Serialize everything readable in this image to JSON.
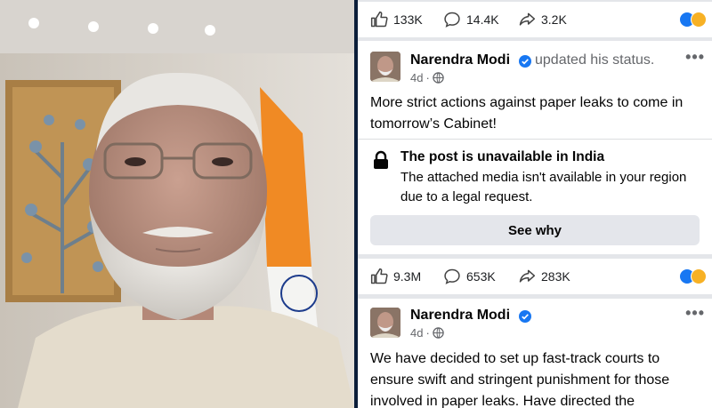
{
  "top_stats": {
    "likes": "133K",
    "comments": "14.4K",
    "shares": "3.2K"
  },
  "post1": {
    "author": "Narendra Modi",
    "action": "updated his status.",
    "time": "4d",
    "text": "More strict actions against paper leaks to come in tomorrow’s Cabinet!",
    "notice_title": "The post is unavailable in India",
    "notice_text": "The attached media isn't available in your region due to a legal request.",
    "button": "See why"
  },
  "mid_stats": {
    "likes": "9.3M",
    "comments": "653K",
    "shares": "283K"
  },
  "post2": {
    "author": "Narendra Modi",
    "time": "4d",
    "text": "We have decided to set up fast-track courts to ensure swift and stringent punishment for those involved in paper leaks. Have directed the"
  },
  "colors": {
    "like_blue": "#1877f2",
    "verified": "#1877f2",
    "laugh": "#f7b125"
  },
  "icons": [
    "like-icon",
    "comment-icon",
    "share-icon",
    "verified-icon",
    "globe-icon",
    "lock-icon",
    "more-icon",
    "reaction-like-icon",
    "reaction-haha-icon"
  ]
}
